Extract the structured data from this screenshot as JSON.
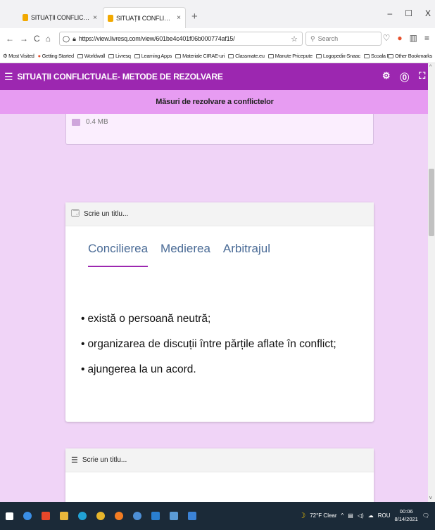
{
  "browser": {
    "tabs": [
      {
        "title": "SITUAȚII CONFLICTUALE- METC",
        "active": false
      },
      {
        "title": "SITUAȚII CONFLICTUALE- METC",
        "active": true
      }
    ],
    "new_tab": "+",
    "window_controls": {
      "minimize": "–",
      "maximize": "☐",
      "close": "X"
    },
    "url": "https://view.livresq.com/view/601be4c401f06b000774af15/",
    "search_placeholder": "Search",
    "bookmarks": [
      "Most Visited",
      "Getting Started",
      "Worldwall",
      "Livresq",
      "Learning Apps",
      "Materiale CIRAE-uri",
      "Classmate.eu",
      "Manute Pricepute",
      "Logopedix-Snaac",
      "Scoala Intuitex"
    ],
    "other_bookmarks": "Other Bookmarks"
  },
  "app": {
    "title": "SITUAȚII CONFLICTUALE- METODE DE REZOLVARE",
    "section_title": "Măsuri de rezolvare a conflictelor"
  },
  "file_card": {
    "size": "0.4 MB"
  },
  "card1": {
    "header_placeholder": "Scrie un titlu...",
    "tabs": [
      "Concilierea",
      "Medierea",
      "Arbitrajul"
    ],
    "active_tab": "Concilierea",
    "bullets": [
      "există o persoană neutră;",
      "organizarea de discuții între părțile aflate în conflict;",
      "ajungerea la un acord."
    ]
  },
  "card2": {
    "header_placeholder": "Scrie un titlu..."
  },
  "taskbar": {
    "weather": "72°F Clear",
    "language": "ROU",
    "time": "00:06",
    "date": "8/14/2021"
  },
  "colors": {
    "header": "#9c27b0",
    "subheader": "#e79cf2",
    "page_bg": "#f0d4f7",
    "tab_text": "#4a6b96"
  }
}
